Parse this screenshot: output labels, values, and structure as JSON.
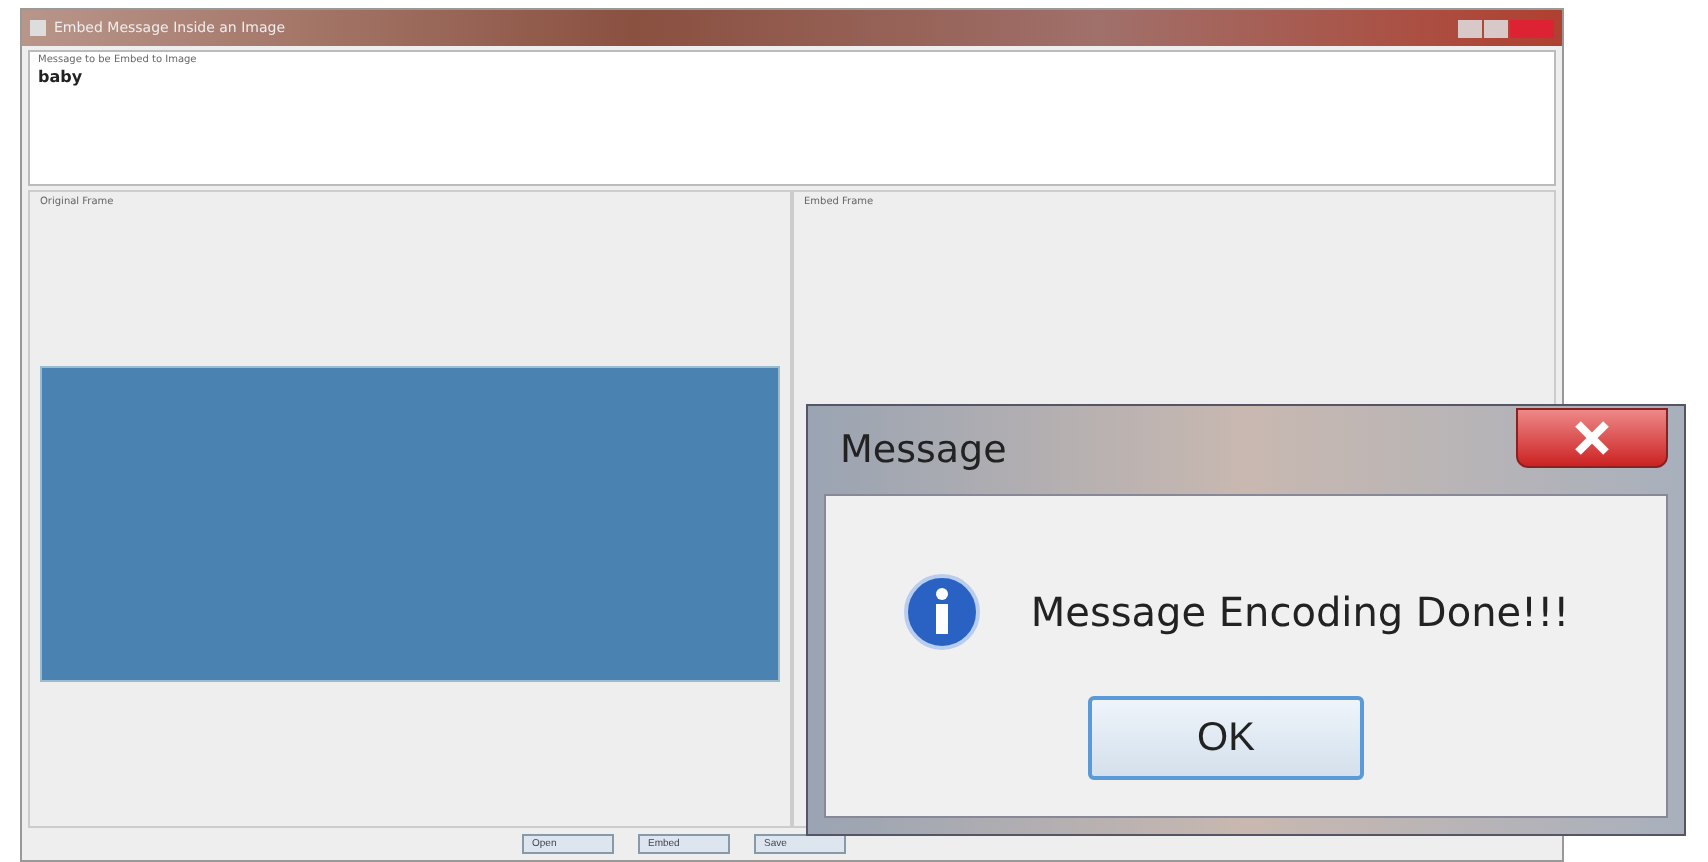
{
  "window": {
    "title": "Embed Message Inside an Image"
  },
  "message_panel": {
    "label": "Message to be Embed to Image",
    "value": "baby"
  },
  "frames": [
    {
      "label": "Original Frame",
      "has_image": true
    },
    {
      "label": "Embed Frame",
      "has_image": false
    }
  ],
  "buttons": [
    "Open",
    "Embed",
    "Save"
  ],
  "dialog": {
    "title": "Message",
    "text": "Message Encoding Done!!!",
    "button": "OK"
  }
}
